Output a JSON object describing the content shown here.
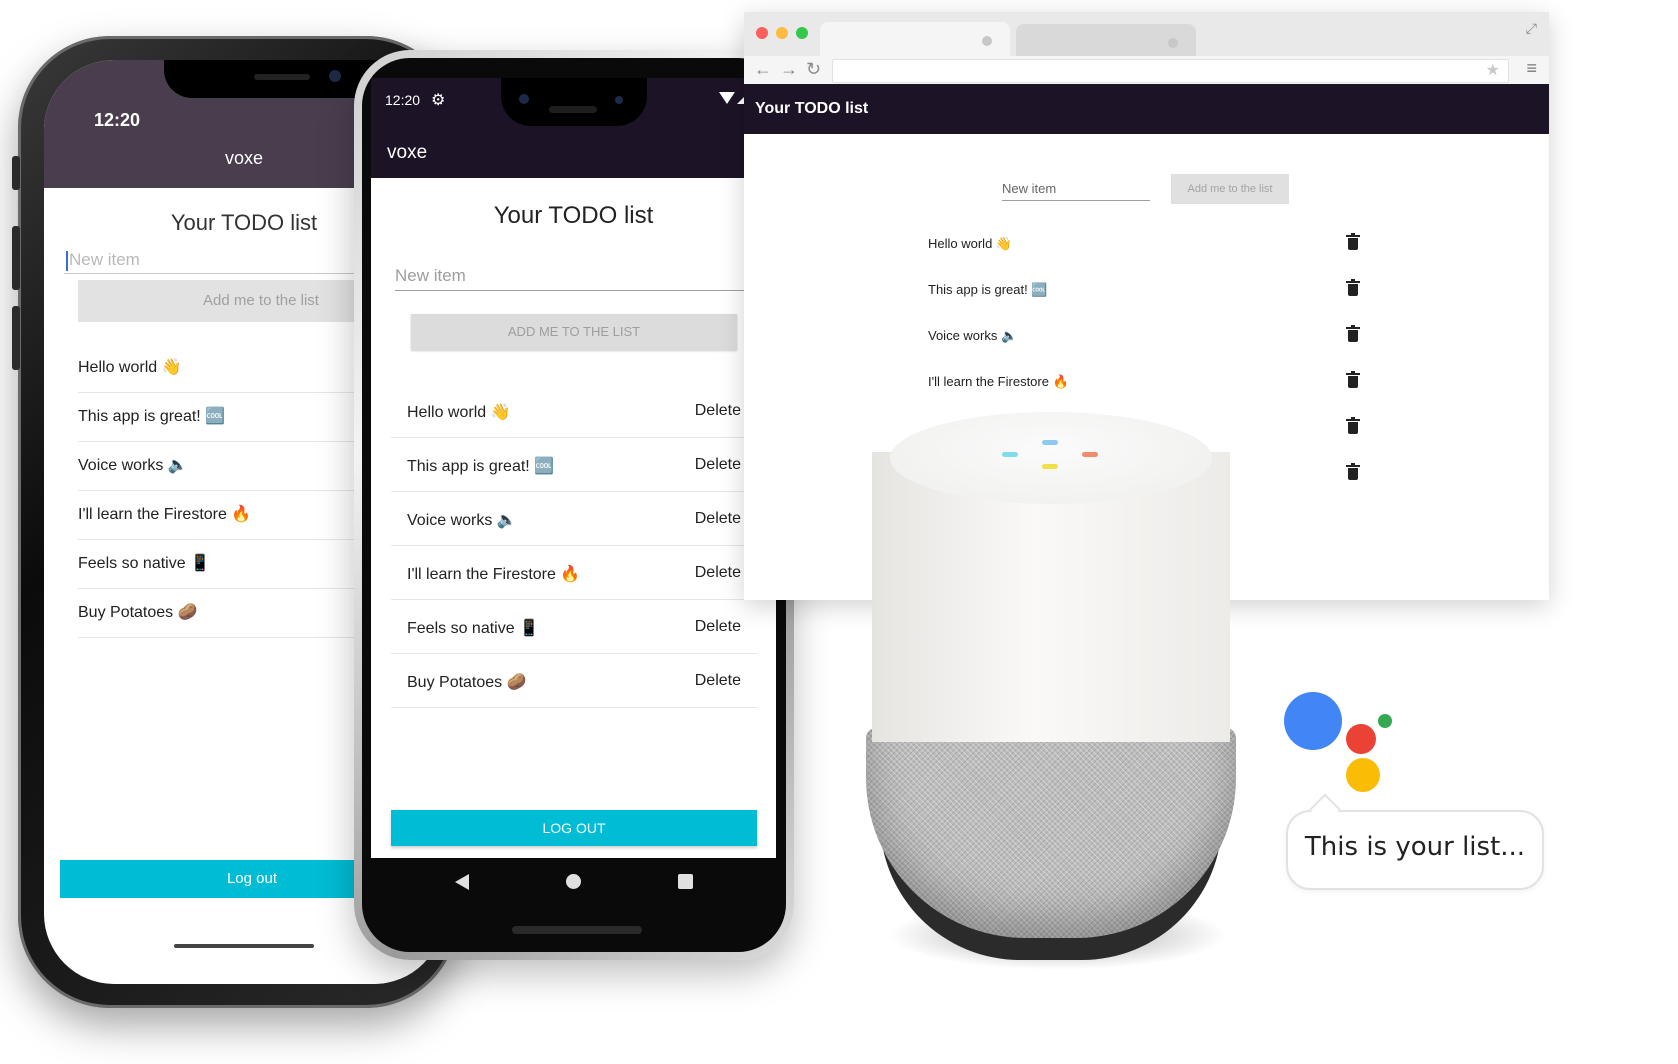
{
  "ios": {
    "time": "12:20",
    "app_name": "voxe",
    "heading": "Your TODO list",
    "input_placeholder": "New item",
    "add_button": "Add me to the list",
    "items": [
      "Hello world 👋",
      "This app is great! 🆒",
      "Voice works 🔈",
      "I'll learn the Firestore 🔥",
      "Feels so native 📱",
      "Buy Potatoes 🥔"
    ],
    "logout_button": "Log out"
  },
  "android": {
    "time": "12:20",
    "app_name": "voxe",
    "heading": "Your TODO list",
    "input_placeholder": "New item",
    "add_button": "ADD ME TO THE LIST",
    "items": [
      {
        "text": "Hello world 👋",
        "action": "Delete"
      },
      {
        "text": "This app is great! 🆒",
        "action": "Delete"
      },
      {
        "text": "Voice works 🔈",
        "action": "Delete"
      },
      {
        "text": "I'll learn the Firestore 🔥",
        "action": "Delete"
      },
      {
        "text": "Feels so native 📱",
        "action": "Delete"
      },
      {
        "text": "Buy Potatoes 🥔",
        "action": "Delete"
      }
    ],
    "logout_button": "LOG OUT"
  },
  "web": {
    "title": "Your TODO list",
    "input_placeholder": "New item",
    "add_button": "Add me to the list",
    "items": [
      "Hello world 👋",
      "This app is great! 🆒",
      "Voice works 🔈",
      "I'll learn the Firestore 🔥"
    ]
  },
  "assistant": {
    "bubble_text": "This is your list..."
  },
  "colors": {
    "appbar": "#1c1326",
    "ios_appbar": "#4a3e4e",
    "accent": "#00bcd4",
    "assistant_blue": "#4285f4",
    "assistant_red": "#ea4335",
    "assistant_yellow": "#fbbc05",
    "assistant_green": "#34a853"
  }
}
